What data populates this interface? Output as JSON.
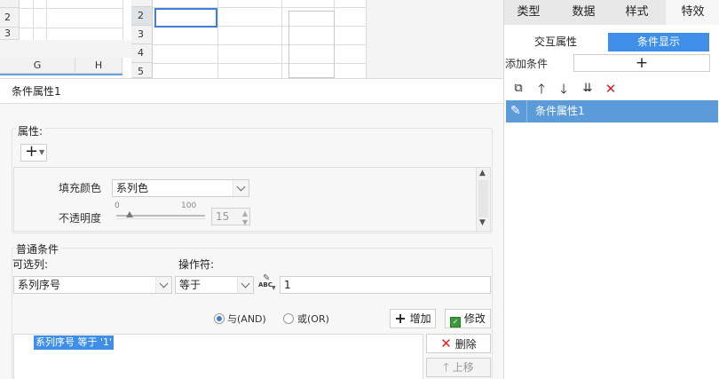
{
  "sheet": {
    "left_rows": [
      "2",
      "3"
    ],
    "left_cols": [
      "G",
      "H"
    ],
    "rows": [
      "2",
      "3",
      "4",
      "5"
    ]
  },
  "dialog": {
    "title": "条件属性1",
    "properties": {
      "label": "属性:",
      "fill_color_label": "填充颜色",
      "fill_color_value": "系列色",
      "opacity_label": "不透明度",
      "opacity_min": "0",
      "opacity_max": "100",
      "opacity_value": "15",
      "opacity_fraction": 0.15
    },
    "condition": {
      "group_label": "普通条件",
      "column_label": "可选列:",
      "column_value": "系列序号",
      "operator_label": "操作符:",
      "operator_value": "等于",
      "value_input": "1",
      "and_label": "与(AND)",
      "or_label": "或(OR)",
      "add_label": "增加",
      "edit_label": "修改",
      "delete_label": "删除",
      "up_label": "上移",
      "expression": "系列序号 等于 '1'"
    }
  },
  "panel": {
    "tabs": [
      "类型",
      "数据",
      "样式",
      "特效"
    ],
    "active_tab": "特效",
    "subtabs": [
      "交互属性",
      "条件显示"
    ],
    "add_condition_label": "添加条件",
    "add_condition_symbol": "+",
    "list_items": [
      "条件属性1"
    ]
  },
  "colors": {
    "accent": "#3f8fe8",
    "selection": "#5b9bd9",
    "delete_red": "#e02020"
  }
}
